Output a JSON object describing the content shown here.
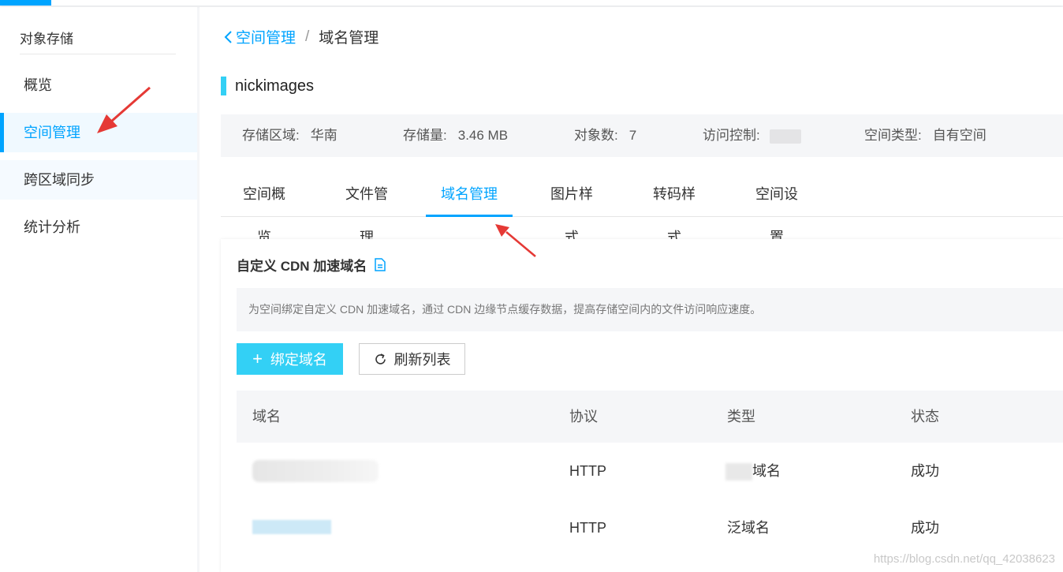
{
  "sidebar": {
    "title": "对象存储",
    "items": [
      {
        "label": "概览"
      },
      {
        "label": "空间管理"
      },
      {
        "label": "跨区域同步"
      },
      {
        "label": "统计分析"
      }
    ]
  },
  "breadcrumb": {
    "back": "空间管理",
    "separator": "/",
    "current": "域名管理"
  },
  "space": {
    "name": "nickimages"
  },
  "info": {
    "region_label": "存储区域:",
    "region_value": "华南",
    "storage_label": "存储量:",
    "storage_value": "3.46 MB",
    "objects_label": "对象数:",
    "objects_value": "7",
    "access_label": "访问控制:",
    "type_label": "空间类型:",
    "type_value": "自有空间"
  },
  "tabs": [
    {
      "label": "空间概览"
    },
    {
      "label": "文件管理"
    },
    {
      "label": "域名管理"
    },
    {
      "label": "图片样式"
    },
    {
      "label": "转码样式"
    },
    {
      "label": "空间设置"
    }
  ],
  "panel": {
    "title": "自定义 CDN 加速域名",
    "tip": "为空间绑定自定义 CDN 加速域名，通过 CDN 边缘节点缓存数据，提高存储空间内的文件访问响应速度。",
    "bind_button": "绑定域名",
    "refresh_button": "刷新列表"
  },
  "table": {
    "columns": [
      "域名",
      "协议",
      "类型",
      "状态"
    ],
    "rows": [
      {
        "protocol": "HTTP",
        "type": "域名",
        "status": "成功"
      },
      {
        "protocol": "HTTP",
        "type": "泛域名",
        "status": "成功"
      }
    ]
  },
  "watermark": "https://blog.csdn.net/qq_42038623",
  "colors": {
    "accent": "#00a4ff",
    "primary_button": "#33d0f5",
    "annotation_arrow": "#e53935"
  },
  "icons": [
    "chevron-left-icon",
    "document-icon",
    "plus-icon",
    "refresh-icon"
  ]
}
